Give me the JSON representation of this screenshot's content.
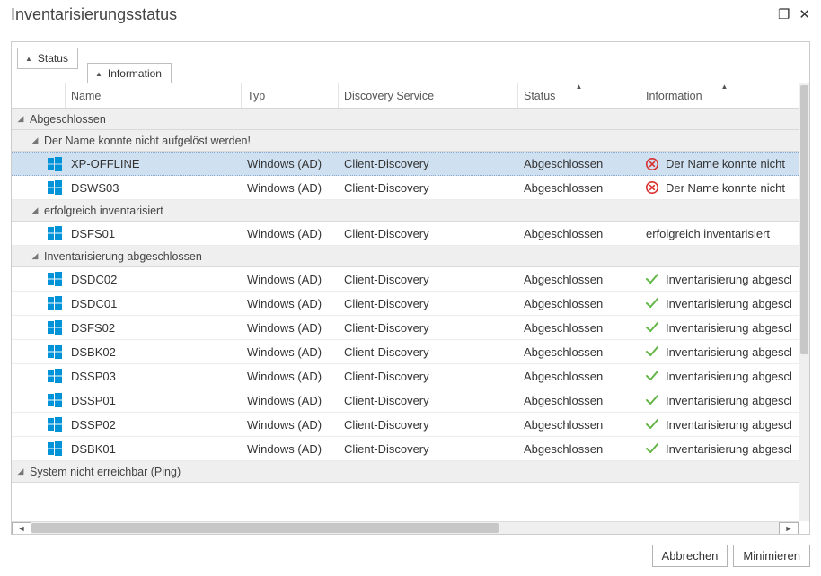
{
  "title": "Inventarisierungsstatus",
  "group_tabs": {
    "status": "Status",
    "information": "Information"
  },
  "columns": {
    "name": "Name",
    "typ": "Typ",
    "discovery": "Discovery Service",
    "status": "Status",
    "information": "Information"
  },
  "groups_top": {
    "abgeschlossen": "Abgeschlossen",
    "system_unreachable": "System nicht erreichbar (Ping)"
  },
  "subgroups": {
    "name_not_resolved": "Der Name konnte nicht aufgelöst werden!",
    "success": "erfolgreich inventarisiert",
    "inv_done": "Inventarisierung abgeschlossen"
  },
  "info_text": {
    "name_not_resolved": "Der Name konnte nicht ",
    "success": "erfolgreich inventarisiert",
    "inv_done": "Inventarisierung abgescl"
  },
  "typ_value": "Windows (AD)",
  "discovery_value": "Client-Discovery",
  "status_value": "Abgeschlossen",
  "rows": {
    "g1": [
      {
        "name": "XP-OFFLINE",
        "selected": true
      },
      {
        "name": "DSWS03"
      }
    ],
    "g2": [
      {
        "name": "DSFS01"
      }
    ],
    "g3": [
      {
        "name": "DSDC02"
      },
      {
        "name": "DSDC01"
      },
      {
        "name": "DSFS02"
      },
      {
        "name": "DSBK02"
      },
      {
        "name": "DSSP03"
      },
      {
        "name": "DSSP01"
      },
      {
        "name": "DSSP02"
      },
      {
        "name": "DSBK01"
      }
    ]
  },
  "buttons": {
    "cancel": "Abbrechen",
    "minimize": "Minimieren"
  },
  "colors": {
    "accent": "#0093d8",
    "error": "#d9302e",
    "ok": "#63b646"
  }
}
